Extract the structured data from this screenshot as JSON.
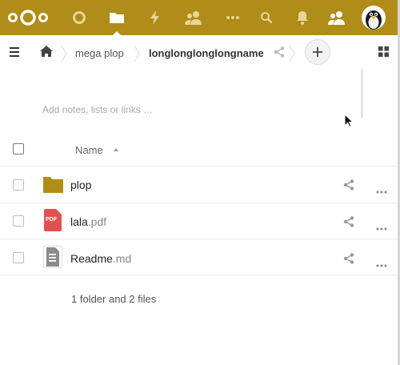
{
  "header": {
    "apps": [
      {
        "name": "logo-icon"
      },
      {
        "name": "dashboard-icon"
      },
      {
        "name": "files-icon"
      },
      {
        "name": "activity-icon"
      },
      {
        "name": "contacts-icon"
      },
      {
        "name": "more-apps-icon"
      }
    ],
    "right": [
      "search-icon",
      "notifications-icon",
      "users-icon",
      "avatar"
    ],
    "bar_color": "#b08c18"
  },
  "breadcrumb": {
    "items": [
      {
        "label": "mega plop"
      },
      {
        "label": "longlonglonglongname"
      }
    ]
  },
  "notes": {
    "placeholder": "Add notes, lists or links …"
  },
  "table": {
    "name_header": "Name",
    "rows": [
      {
        "base": "plop",
        "ext": "",
        "type": "folder"
      },
      {
        "base": "lala",
        "ext": ".pdf",
        "type": "pdf",
        "badge": "PDF"
      },
      {
        "base": "Readme",
        "ext": ".md",
        "type": "text"
      }
    ]
  },
  "summary": "1 folder and 2 files",
  "colors": {
    "accent": "#b08c18",
    "pdf": "#e0514f",
    "folder": "#b08c18"
  }
}
